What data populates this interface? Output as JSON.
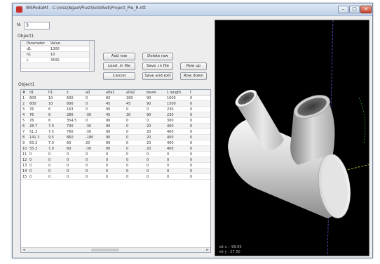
{
  "window": {
    "title": "WSPedaMt - C:\\ross\\Ngao\\Plust\\SolidSet\\Project_Pie_R.ntt",
    "min": "–",
    "max": "□",
    "close": "✕"
  },
  "n_field": {
    "label": "N:",
    "value": "3"
  },
  "object1": {
    "label": "Object1",
    "headers": [
      "Parameter",
      "Value"
    ],
    "rows": [
      [
        "d1",
        "1300"
      ],
      [
        "h1",
        "10"
      ],
      [
        "L",
        "3500"
      ],
      [
        "",
        ""
      ]
    ]
  },
  "buttons": {
    "add_row": "Add row",
    "delete_row": "Delete row",
    "load_file": "Load .in file",
    "save_file": "Save .in file",
    "row_up": "Row up",
    "cancel": "Cancel",
    "save_exit": "Save and exit",
    "row_down": "Row down"
  },
  "object2": {
    "label": "Object1",
    "headers": [
      "#",
      "d1",
      "h1",
      "z",
      "a0",
      "alfa1",
      "alfa2",
      "bevel",
      "L length",
      "f"
    ],
    "rows": [
      [
        "1",
        "600",
        "10",
        "600",
        "0",
        "60",
        "180",
        "90",
        "1000",
        "0"
      ],
      [
        "2",
        "600",
        "10",
        "800",
        "0",
        "45",
        "45",
        "90",
        "1500",
        "0"
      ],
      [
        "3",
        "76",
        "6",
        "163",
        "0",
        "90",
        "0",
        "0",
        "230",
        "0"
      ],
      [
        "4",
        "76",
        "6",
        "280",
        "-30",
        "45",
        "30",
        "90",
        "230",
        "0"
      ],
      [
        "5",
        "76",
        "6",
        "354.5",
        "0",
        "90",
        "0",
        "0",
        "300",
        "0"
      ],
      [
        "6",
        "28.7",
        "7.0",
        "730",
        "-30",
        "90",
        "0",
        "20",
        "400",
        "0"
      ],
      [
        "7",
        "51.3",
        "7.5",
        "760",
        "-30",
        "90",
        "0",
        "20",
        "400",
        "0"
      ],
      [
        "8",
        "141.3",
        "9.5",
        "860",
        "-180",
        "90",
        "0",
        "20",
        "400",
        "0"
      ],
      [
        "9",
        "63.3",
        "7.0",
        "60",
        "20",
        "90",
        "0",
        "20",
        "400",
        "0"
      ],
      [
        "10",
        "55.3",
        "7.0",
        "60",
        "-30",
        "90",
        "0",
        "20",
        "400",
        "0"
      ],
      [
        "11",
        "0",
        "0",
        "0",
        "0",
        "0",
        "0",
        "0",
        "0",
        "0"
      ],
      [
        "12",
        "0",
        "0",
        "0",
        "0",
        "0",
        "0",
        "0",
        "0",
        "0"
      ],
      [
        "13",
        "0",
        "0",
        "0",
        "0",
        "0",
        "0",
        "0",
        "0",
        "0"
      ],
      [
        "14",
        "0",
        "0",
        "0",
        "0",
        "0",
        "0",
        "0",
        "0",
        "0"
      ],
      [
        "15",
        "0",
        "0",
        "0",
        "0",
        "0",
        "0",
        "0",
        "0",
        "0"
      ]
    ],
    "scroll_left": "◄",
    "scroll_right": "►"
  },
  "viewport": {
    "coord_x": "rot x : -99.00",
    "coord_y": "rot y : 27.50"
  }
}
